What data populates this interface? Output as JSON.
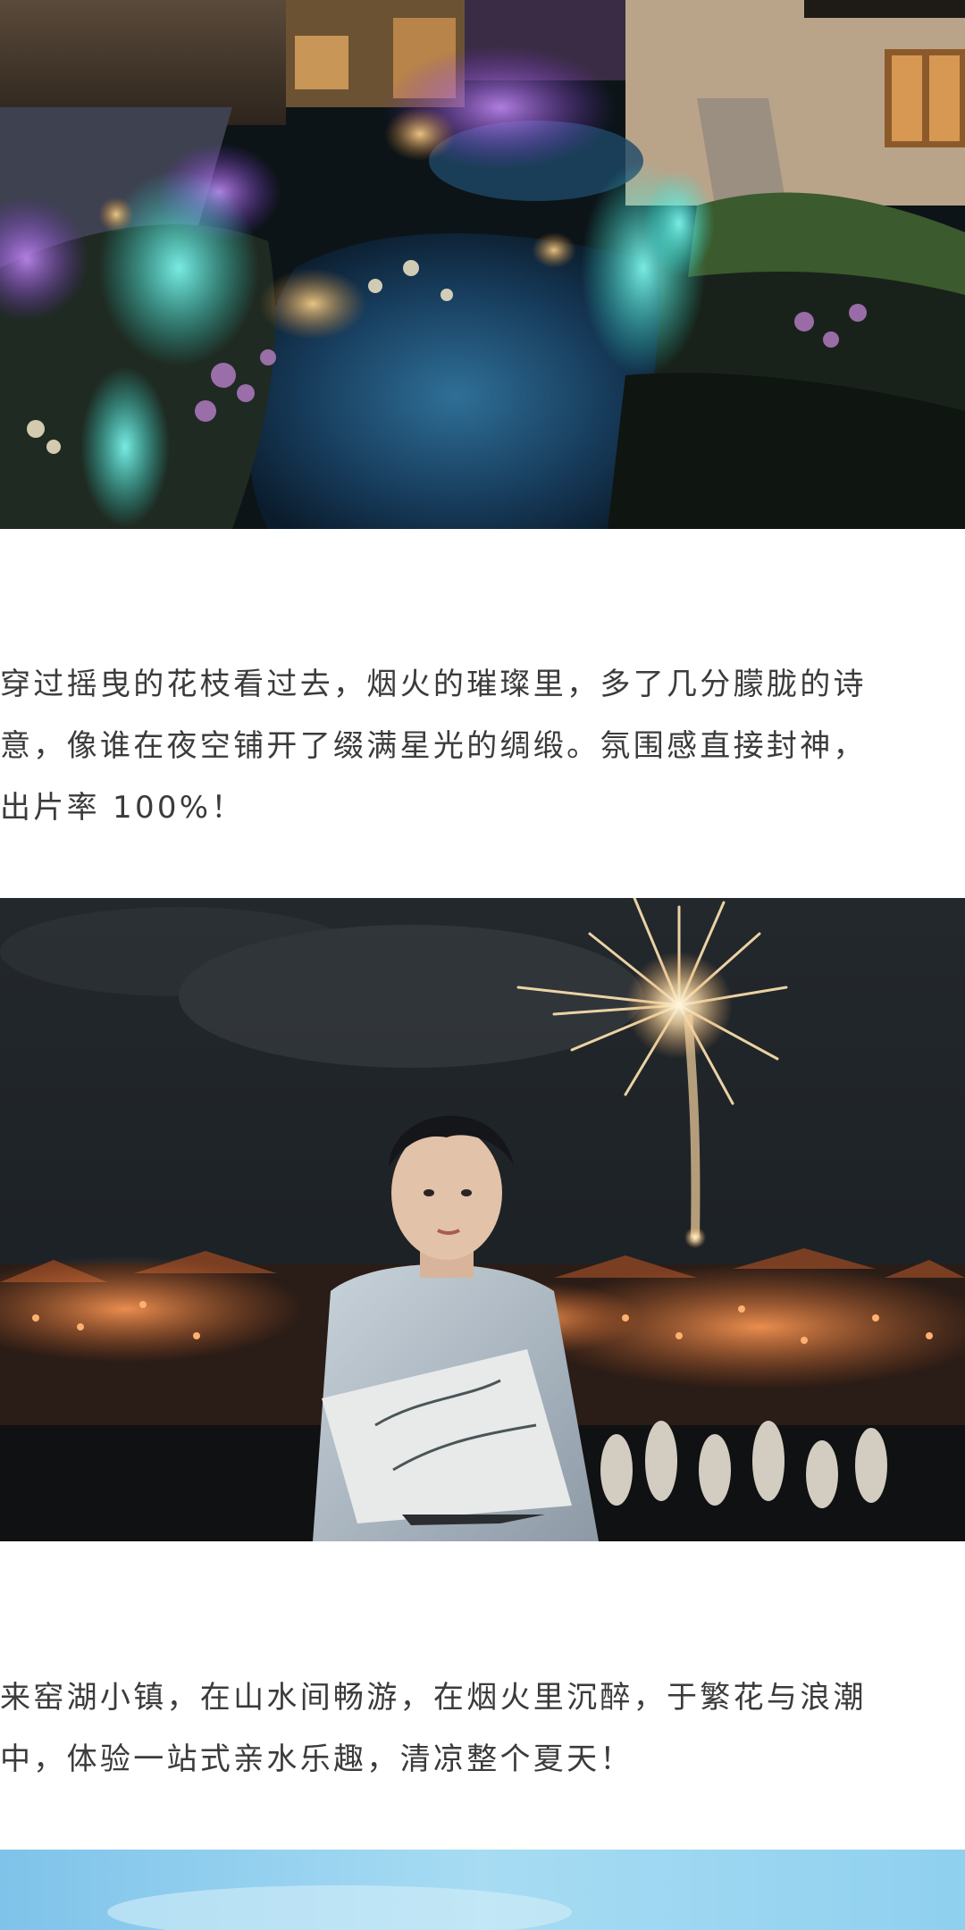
{
  "article": {
    "paragraph_1": {
      "lines": [
        "穿过摇曳的花枝看过去，烟火的璀璨里，多了几分朦胧的诗",
        "意，像谁在夜空铺开了缀满星光的绸缎。氛围感直接封神，",
        "出片率 100%！"
      ]
    },
    "paragraph_2": {
      "lines": [
        "来窑湖小镇，在山水间畅游，在烟火里沉醉，于繁花与浪潮",
        "中，体验一站式亲水乐趣，清凉整个夏天！"
      ]
    }
  },
  "colors": {
    "background": "#ffffff",
    "text": "#3b3b3b",
    "night_sky": "#1e2226",
    "town_lights": "#d9733a",
    "water_glow": "#2ee6d6",
    "purple_light": "#9b4de0",
    "sky_blue": "#8fd0ef"
  }
}
